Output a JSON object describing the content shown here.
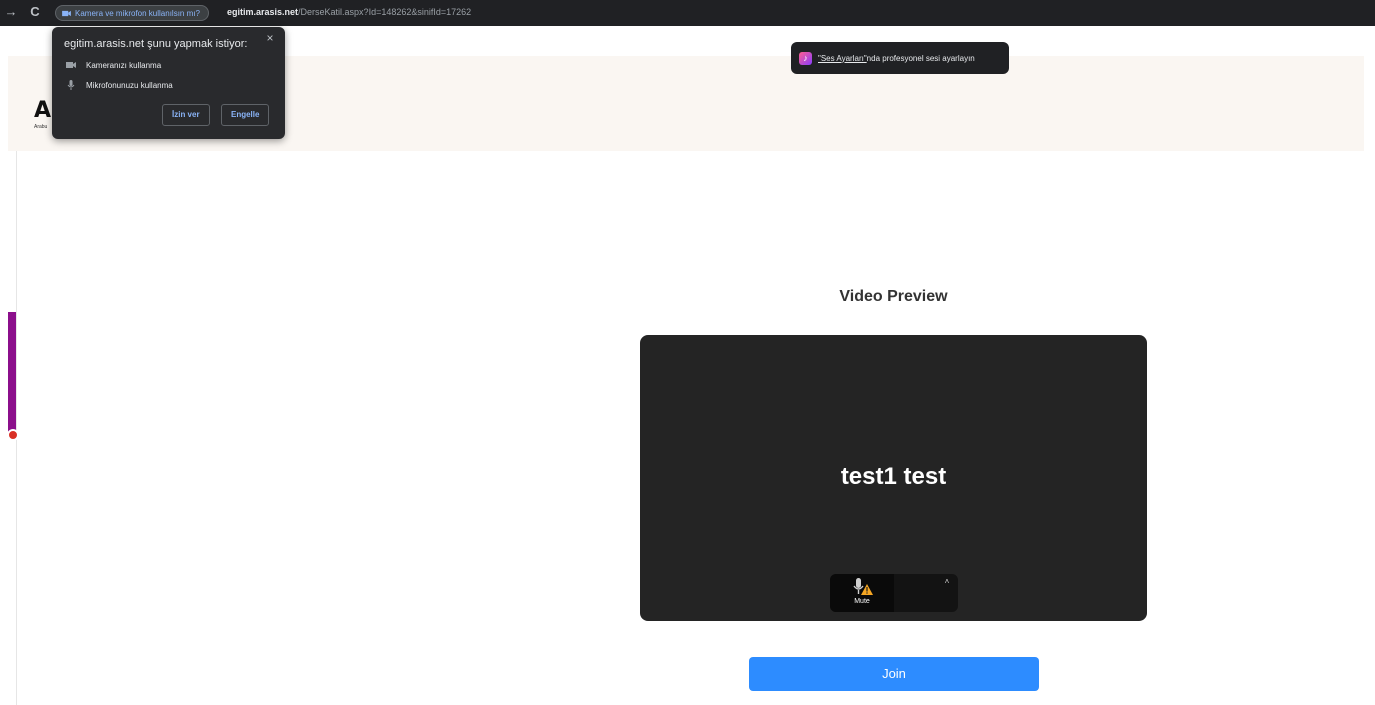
{
  "browser": {
    "back_glyph": "→",
    "reload_glyph": "C",
    "permission_chip": "Kamera ve mikrofon kullanılsın mı?",
    "url_host": "egitim.arasis.net",
    "url_path": "/DerseKatil.aspx?Id=148262&sinifId=17262"
  },
  "permission_popup": {
    "title": "egitim.arasis.net şunu yapmak istiyor:",
    "close_glyph": "×",
    "items": [
      {
        "icon": "camera-icon",
        "label": "Kameranızı kullanma"
      },
      {
        "icon": "microphone-icon",
        "label": "Mikrofonunuzu kullanma"
      }
    ],
    "allow_label": "İzin ver",
    "block_label": "Engelle"
  },
  "toast": {
    "link_text": "\"Ses Ayarları\"",
    "rest_text": "nda profesyonel sesi ayarlayın"
  },
  "logo": {
    "letter": "A",
    "sub": "Arabu"
  },
  "main": {
    "preview_title": "Video Preview",
    "participant_name": "test1 test",
    "mute_label": "Mute",
    "caret_glyph": "˄",
    "join_label": "Join"
  },
  "colors": {
    "join": "#2d8cff",
    "video_bg": "#242424",
    "side_tab": "#8b0f8b",
    "chip_text": "#8ab4f8"
  }
}
